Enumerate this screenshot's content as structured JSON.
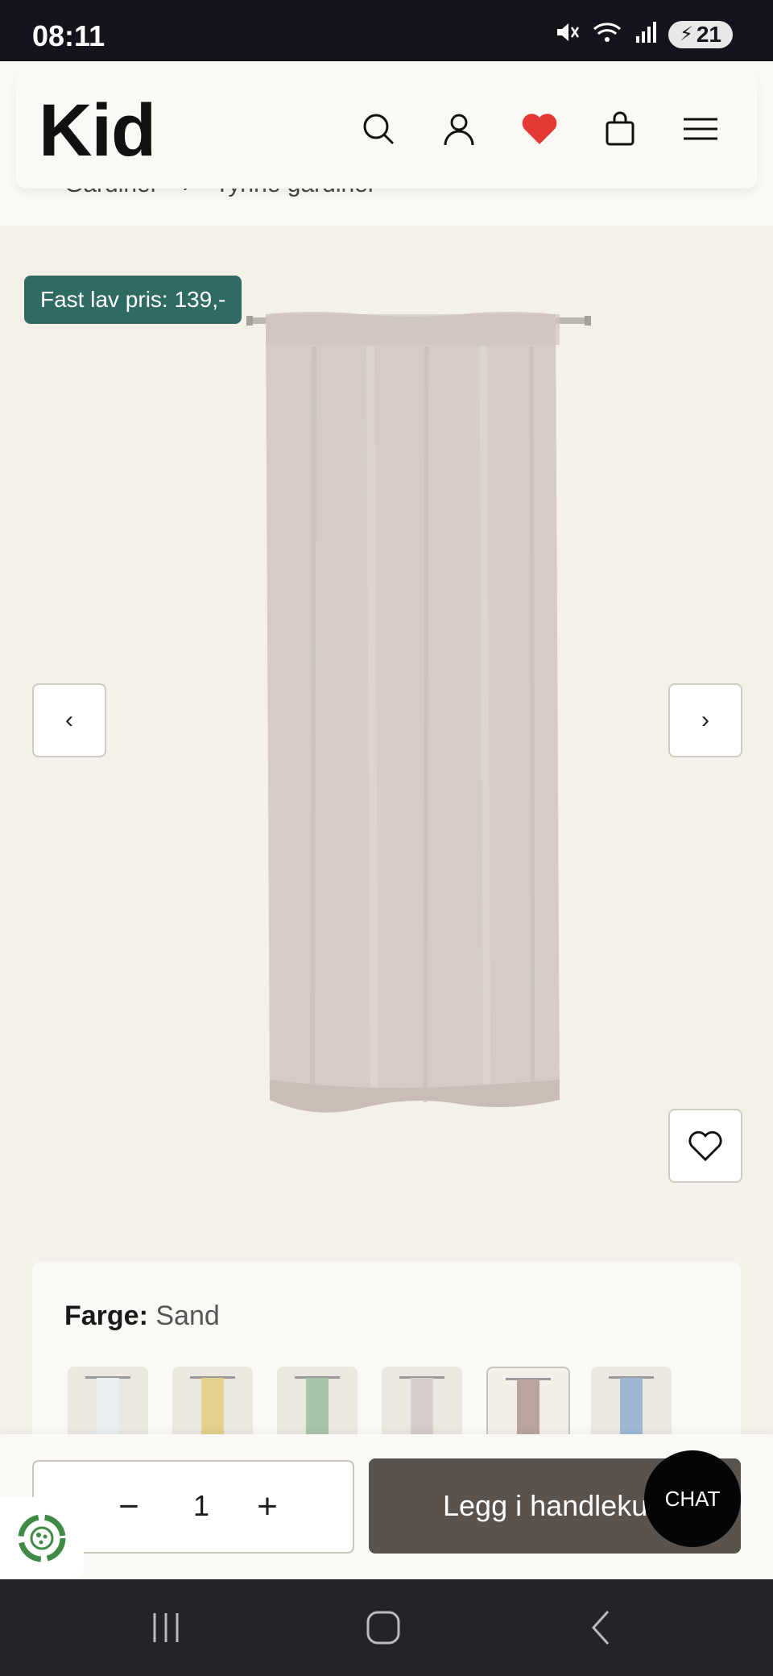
{
  "status": {
    "time": "08:11",
    "battery": "21"
  },
  "header": {
    "logo": "Kid",
    "icons": [
      "search-icon",
      "user-icon",
      "heart-icon",
      "bag-icon",
      "menu-icon"
    ],
    "favorite_color": "#e53935"
  },
  "breadcrumb": {
    "items": [
      "Gardiner",
      "Tynne gardiner"
    ]
  },
  "product": {
    "price_badge": "Fast lav pris: 139,-",
    "badge_color": "#2f6b62",
    "image_color": "#d6cbc5"
  },
  "options": {
    "color_label": "Farge:",
    "color_value": "Sand",
    "swatches": [
      {
        "name": "hvit",
        "color": "#e8eef2",
        "selected": false
      },
      {
        "name": "gul",
        "color": "#e3cf8e",
        "selected": false
      },
      {
        "name": "grønn",
        "color": "#a9c4a8",
        "selected": false
      },
      {
        "name": "lys grå",
        "color": "#d4cdcb",
        "selected": false
      },
      {
        "name": "sand",
        "color": "#b9a49e",
        "selected": true
      },
      {
        "name": "blå",
        "color": "#9fb6d3",
        "selected": false
      }
    ]
  },
  "cart": {
    "quantity": "1",
    "minus": "−",
    "plus": "+",
    "add_label": "Legg i handlekurv",
    "button_color": "#5a524d"
  },
  "chat": {
    "label": "CHAT"
  },
  "system_nav": [
    "recents-icon",
    "home-icon",
    "back-icon"
  ]
}
